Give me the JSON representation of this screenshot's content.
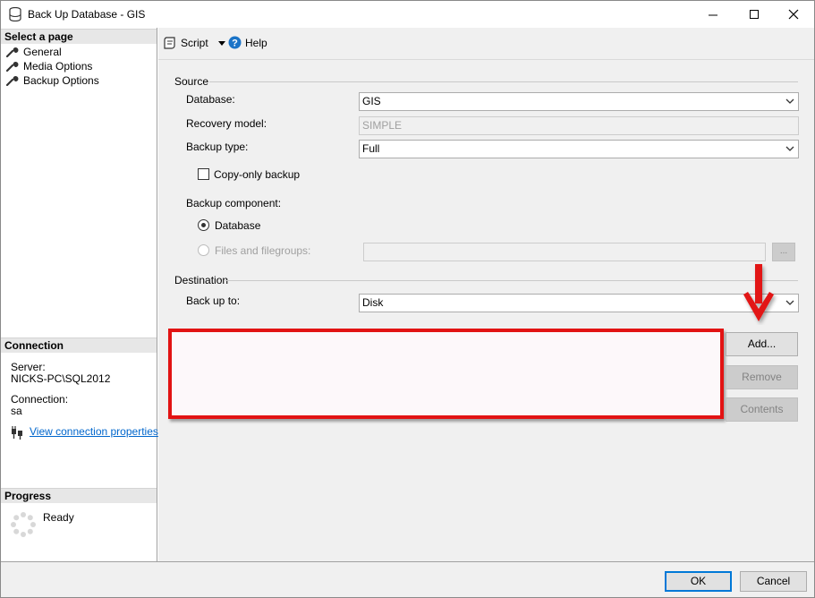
{
  "window": {
    "title": "Back Up Database - GIS"
  },
  "left": {
    "select_page_heading": "Select a page",
    "pages": [
      {
        "label": "General"
      },
      {
        "label": "Media Options"
      },
      {
        "label": "Backup Options"
      }
    ],
    "connection_heading": "Connection",
    "server_label": "Server:",
    "server_value": "NICKS-PC\\SQL2012",
    "connection_label": "Connection:",
    "connection_value": "sa",
    "view_connection_link": "View connection properties",
    "progress_heading": "Progress",
    "progress_status": "Ready"
  },
  "toolbar": {
    "script_label": "Script",
    "help_label": "Help"
  },
  "source": {
    "heading": "Source",
    "database_label": "Database:",
    "database_value": "GIS",
    "recovery_model_label": "Recovery model:",
    "recovery_model_value": "SIMPLE",
    "backup_type_label": "Backup type:",
    "backup_type_value": "Full",
    "copy_only_label": "Copy-only backup",
    "copy_only_checked": false,
    "backup_component_label": "Backup component:",
    "component_database_label": "Database",
    "component_files_label": "Files and filegroups:",
    "files_browse_label": "..."
  },
  "destination": {
    "heading": "Destination",
    "back_up_to_label": "Back up to:",
    "back_up_to_value": "Disk",
    "add_button": "Add...",
    "remove_button": "Remove",
    "contents_button": "Contents"
  },
  "footer": {
    "ok_button": "OK",
    "cancel_button": "Cancel"
  },
  "colors": {
    "highlight_border": "#e21313",
    "arrow": "#e21313",
    "link": "#0066cc",
    "ok_border": "#0078d7"
  }
}
